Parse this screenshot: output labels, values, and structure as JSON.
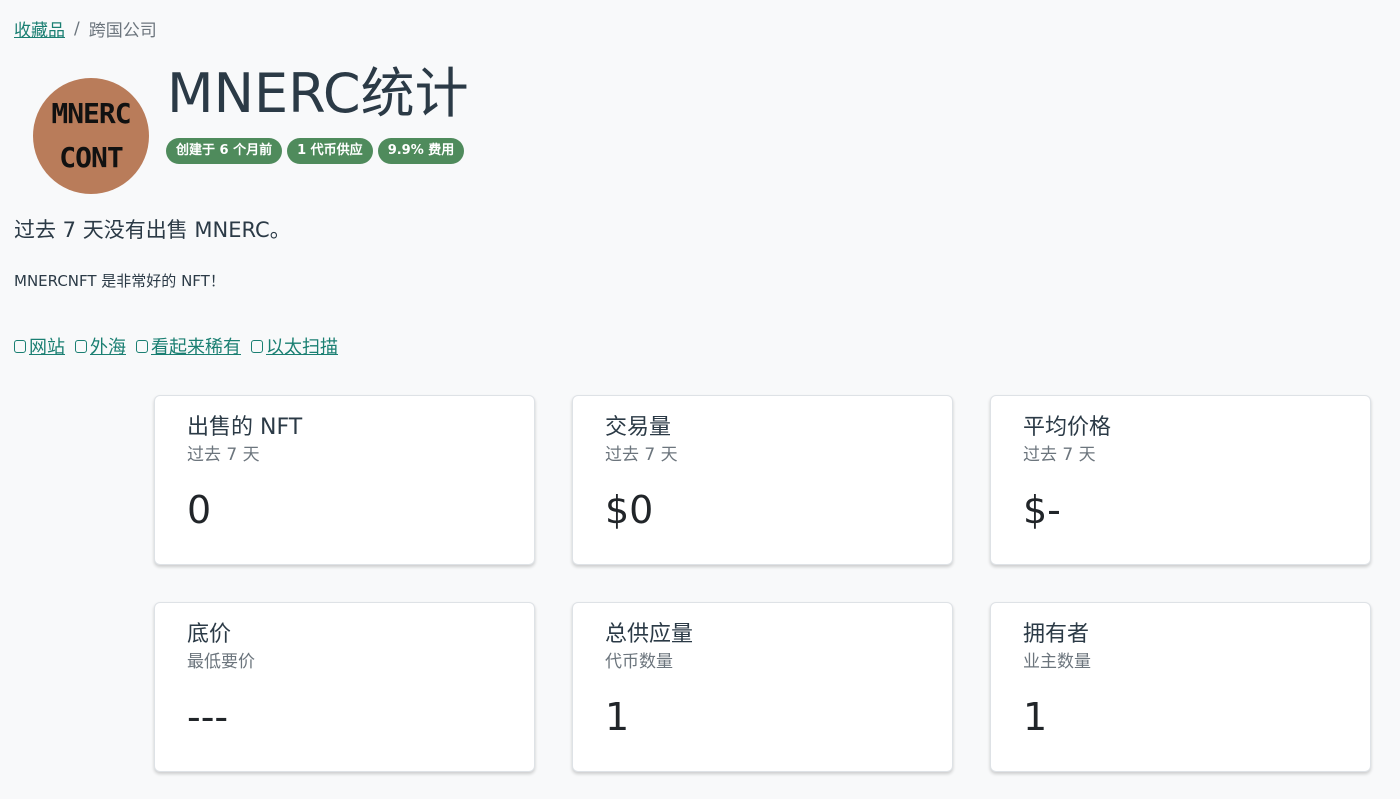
{
  "breadcrumb": {
    "parent": "收藏品",
    "separator": "/",
    "current": "跨国公司"
  },
  "logo": {
    "line1": "MNERC",
    "line2": "CONT",
    "color": "#b97c5a"
  },
  "title": "MNERC统计",
  "badges": [
    "创建于 6 个月前",
    "1 代币供应",
    "9.9% 费用"
  ],
  "summary": "过去 7 天没有出售 MNERC。",
  "description": "MNERCNFT 是非常好的 NFT！",
  "links": [
    {
      "label": "网站",
      "icon": "bookmark-icon"
    },
    {
      "label": "外海",
      "icon": "square-icon"
    },
    {
      "label": "看起来稀有",
      "icon": "square-icon"
    },
    {
      "label": "以太扫描",
      "icon": "square-icon"
    }
  ],
  "cards": [
    {
      "title": "出售的 NFT",
      "subtitle": "过去 7 天",
      "value": "0"
    },
    {
      "title": "交易量",
      "subtitle": "过去 7 天",
      "value": "$0"
    },
    {
      "title": "平均价格",
      "subtitle": "过去 7 天",
      "value": "$-"
    },
    {
      "title": "底价",
      "subtitle": "最低要价",
      "value": "---"
    },
    {
      "title": "总供应量",
      "subtitle": "代币数量",
      "value": "1"
    },
    {
      "title": "拥有者",
      "subtitle": "业主数量",
      "value": "1"
    }
  ],
  "colors": {
    "accent": "#1a7f72",
    "badge": "#4f8b5c",
    "background": "#f8f9fa"
  }
}
